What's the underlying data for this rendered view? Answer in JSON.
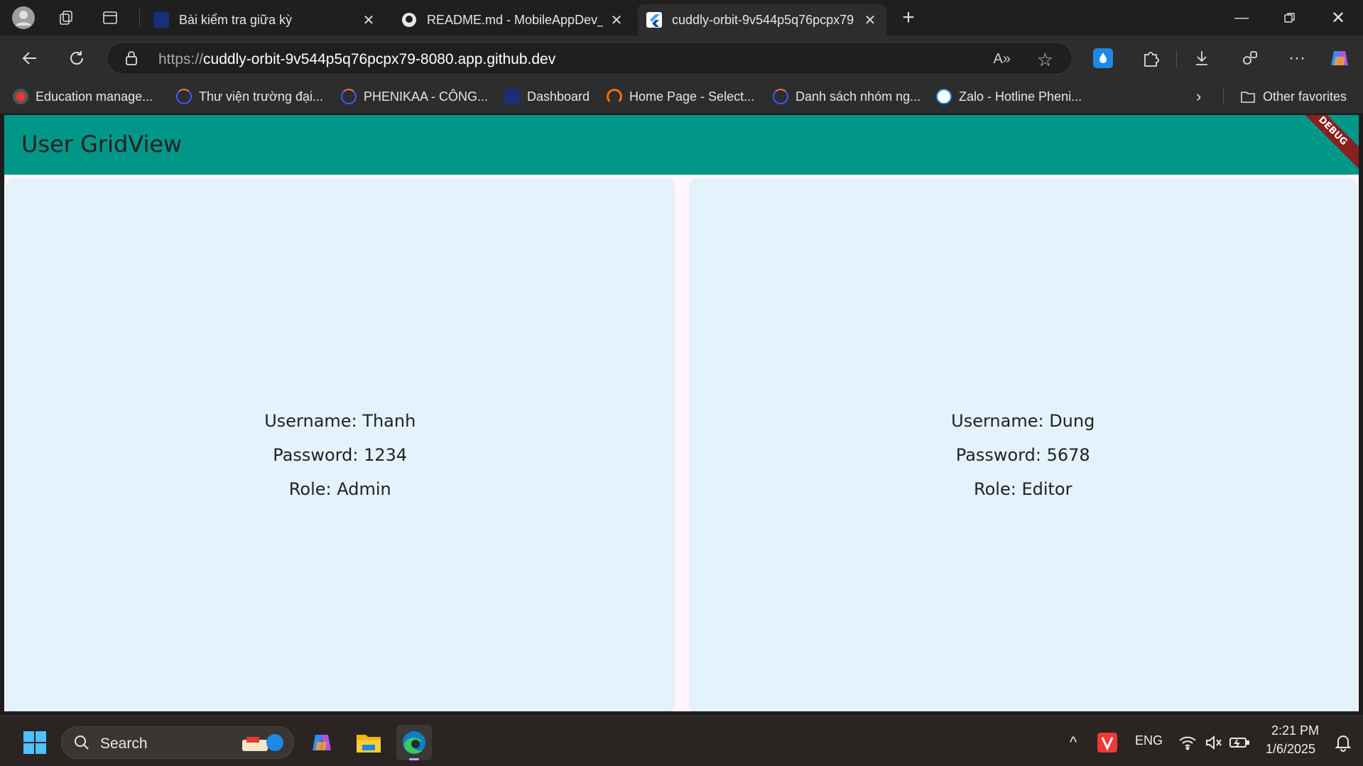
{
  "browser": {
    "tabs": [
      {
        "title": "Bài kiểm tra giữa kỳ",
        "active": false
      },
      {
        "title": "README.md - MobileAppDev_N",
        "active": false
      },
      {
        "title": "cuddly-orbit-9v544p5q76pcpx79",
        "active": true
      }
    ],
    "address": {
      "scheme": "https://",
      "host": "cuddly-orbit-9v544p5q76pcpx79-8080.app.github.dev"
    },
    "favorites": [
      "Education manage...",
      "Thư viện trường đại...",
      "PHENIKAA - CÔNG...",
      "Dashboard",
      "Home Page - Select...",
      "Danh sách nhóm ng...",
      "Zalo - Hotline Pheni..."
    ],
    "other_favorites": "Other favorites"
  },
  "app": {
    "title": "User GridView",
    "debug_banner": "DEBUG",
    "appbar_color": "#009688",
    "card_color": "#e3f2fd",
    "users": [
      {
        "username": "Username: Thanh",
        "password": "Password: 1234",
        "role": "Role: Admin"
      },
      {
        "username": "Username: Dung",
        "password": "Password: 5678",
        "role": "Role: Editor"
      }
    ]
  },
  "taskbar": {
    "search_label": "Search",
    "language": "ENG",
    "time": "2:21 PM",
    "date": "1/6/2025"
  }
}
